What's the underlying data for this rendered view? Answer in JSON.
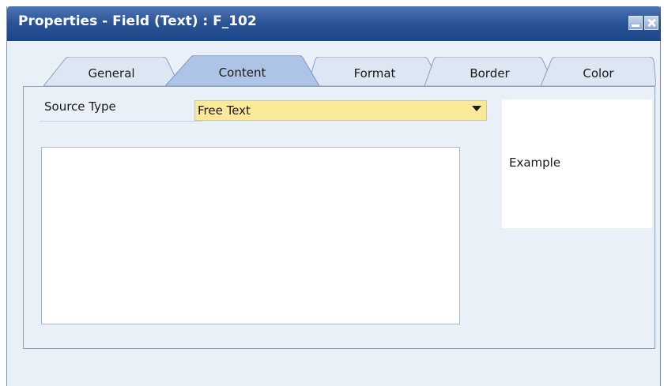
{
  "window": {
    "title": "Properties - Field (Text) : F_102"
  },
  "tabs": [
    {
      "label": "General",
      "active": false
    },
    {
      "label": "Content",
      "active": true
    },
    {
      "label": "Format",
      "active": false
    },
    {
      "label": "Border",
      "active": false
    },
    {
      "label": "Color",
      "active": false
    }
  ],
  "content": {
    "source_type_label": "Source Type",
    "source_type_value": "Free Text",
    "text_value": "",
    "example_text": "Example"
  },
  "colors": {
    "titlebar": "#2c5597",
    "panel_bg": "#eaf0f8",
    "select_bg": "#fbe99a",
    "active_tab": "#aec4e6",
    "inactive_tab": "#dde6f3"
  },
  "icons": {
    "minimize": "minimize-icon",
    "close": "close-icon",
    "dropdown": "chevron-down-icon"
  }
}
